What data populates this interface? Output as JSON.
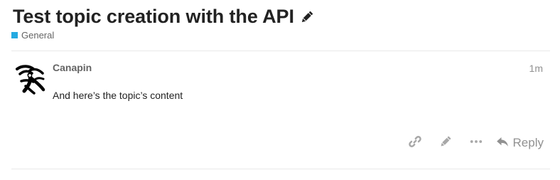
{
  "topic": {
    "title": "Test topic creation with the API",
    "category": "General"
  },
  "post": {
    "username": "Canapin",
    "date": "1m",
    "content": "And here’s the topic’s content"
  },
  "actions": {
    "reply_label": "Reply"
  },
  "colors": {
    "category_swatch": "#25aae1",
    "muted_text": "#919191",
    "title_text": "#222222"
  },
  "icons": [
    "pencil-icon",
    "link-icon",
    "pencil-icon",
    "ellipsis-icon",
    "reply-icon"
  ]
}
